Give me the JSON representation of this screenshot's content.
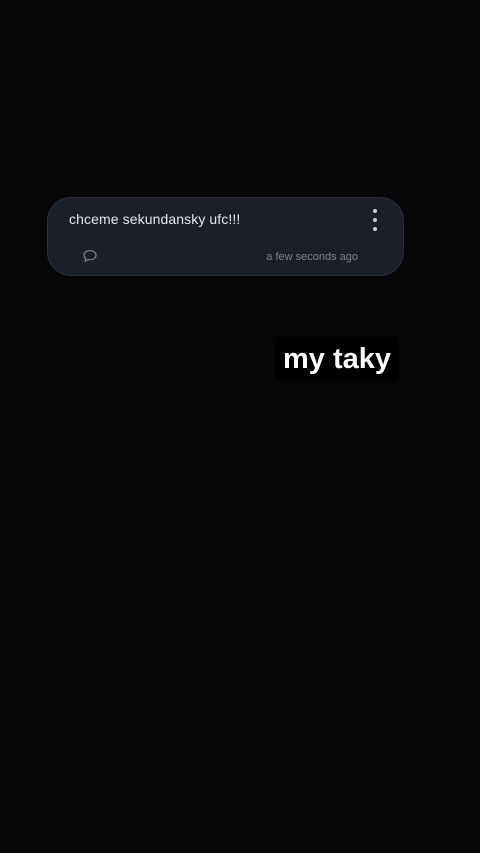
{
  "notification": {
    "text": "chceme sekundansky ufc!!!",
    "timestamp": "a few seconds ago",
    "menu_icon": "more-vertical-icon",
    "comment_icon": "comment-bubble-icon"
  },
  "caption": {
    "text": "my taky"
  },
  "colors": {
    "background": "#060606",
    "card": "#1b1f27",
    "card_text": "#e6e8ec",
    "muted": "#7e838c",
    "caption_bg": "#000000",
    "caption_text": "#ffffff"
  }
}
